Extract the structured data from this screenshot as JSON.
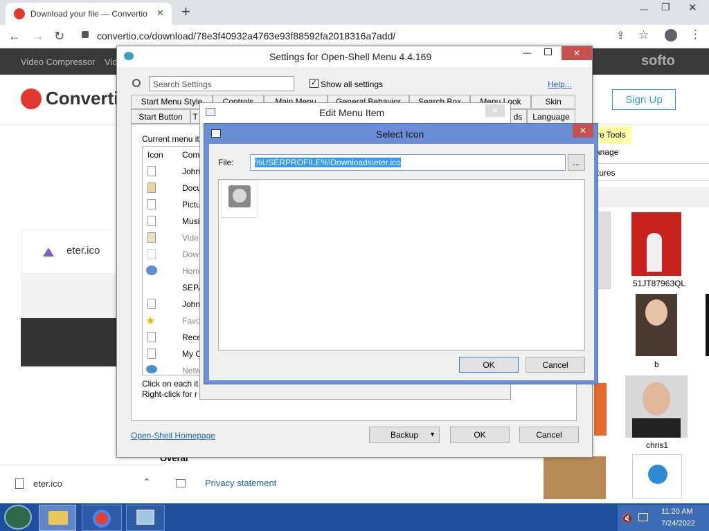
{
  "browser": {
    "tab_title": "Download your file — Convertio",
    "new_tab_symbol": "+",
    "address": "convertio.co/download/78e3f40932a4763e93f88592fa2018316a7add/",
    "window_controls": {
      "min": "—",
      "max": "❐",
      "close": "✕"
    }
  },
  "site": {
    "nav_items": [
      "Video Compressor",
      "Vid"
    ],
    "logo_text": "Convertio",
    "softo": "softo",
    "sign_up": "Sign Up",
    "file_name": "eter.ico",
    "overall_text": "Overal",
    "privacy": "Privacy statement"
  },
  "downloads_bar": {
    "file": "eter.ico"
  },
  "explorer": {
    "ribbon_tab": "re Tools",
    "manage": "anage",
    "path_frag": "tures",
    "thumbs": [
      {
        "label": "51JT87963QL",
        "kind": "book"
      },
      {
        "label": "b",
        "kind": "person"
      },
      {
        "label": "chris1",
        "kind": "person"
      }
    ]
  },
  "settings": {
    "title": "Settings for Open-Shell Menu 4.4.169",
    "search_placeholder": "Search Settings",
    "show_all": "Show all settings",
    "help": "Help...",
    "tabs_row1": [
      "Start Menu Style",
      "Controls",
      "Main Menu",
      "General Behavior",
      "Search Box",
      "Menu Look",
      "Skin"
    ],
    "tabs_row2": [
      "Start Button",
      "T",
      "ds",
      "Language"
    ],
    "current_menu_label": "Current menu it",
    "col_icon": "Icon",
    "col_command": "Com",
    "rows": [
      "John",
      "Docu",
      "Pictu",
      "Musi",
      "Vide",
      "Dow",
      "Hom",
      "SEPA",
      "John",
      "Favo",
      "Rece",
      "My C",
      "Netw"
    ],
    "footer1": "Click on each it",
    "footer2": "Right-click for r",
    "homepage": "Open-Shell Homepage",
    "backup": "Backup",
    "ok": "OK",
    "cancel": "Cancel"
  },
  "edit_menu": {
    "title": "Edit Menu Item"
  },
  "select_icon": {
    "title": "Select Icon",
    "file_label": "File:",
    "file_value": "%USERPROFILE%\\Downloads\\eter.ico",
    "browse": "...",
    "ok": "OK",
    "cancel": "Cancel"
  },
  "taskbar": {
    "time": "11:20 AM",
    "date": "7/24/2022"
  },
  "colors": {
    "accent_blue": "#1a5fb4",
    "dialog_frame": "#6b8ed6",
    "convertio_red": "#e0392f",
    "taskbar": "#1f4e9c"
  }
}
